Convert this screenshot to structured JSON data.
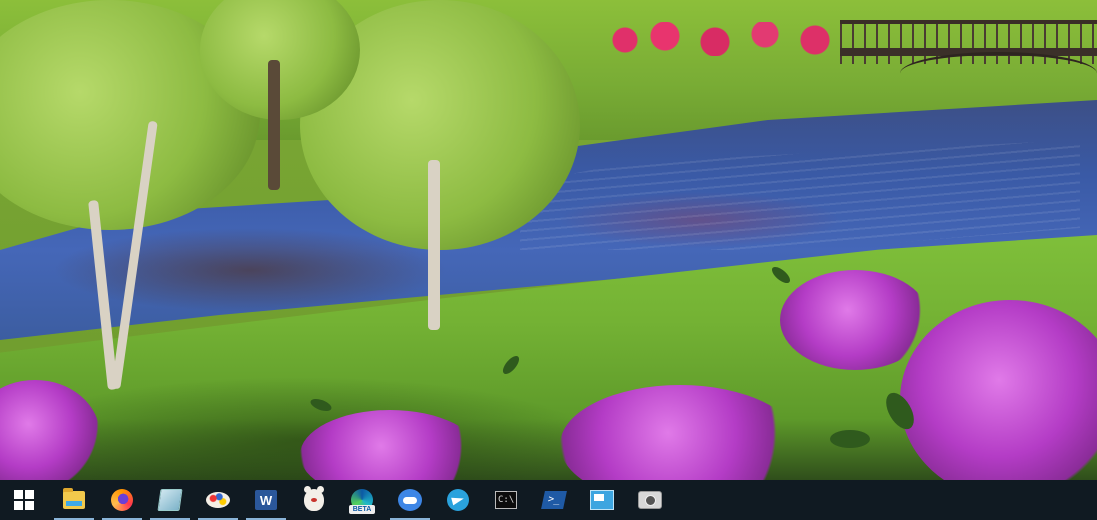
{
  "desktop": {
    "wallpaper": "landscape-pond-bridge-azaleas"
  },
  "taskbar": {
    "background": "#101a22",
    "start": {
      "icon": "windows-start-icon"
    },
    "items": [
      {
        "id": "file-explorer",
        "icon": "folder-icon",
        "active": true
      },
      {
        "id": "firefox",
        "icon": "firefox-icon",
        "active": true
      },
      {
        "id": "app-window",
        "icon": "window-app-icon",
        "active": true
      },
      {
        "id": "paint",
        "icon": "paint-palette-icon",
        "active": true
      },
      {
        "id": "word",
        "icon": "word-icon",
        "label": "W",
        "active": true
      },
      {
        "id": "bear-app",
        "icon": "bear-icon",
        "active": false
      },
      {
        "id": "edge-beta",
        "icon": "edge-beta-icon",
        "label": "BETA",
        "active": false
      },
      {
        "id": "cloud-app",
        "icon": "cloud-icon",
        "active": true
      },
      {
        "id": "telegram",
        "icon": "telegram-icon",
        "active": false
      },
      {
        "id": "command-prompt",
        "icon": "terminal-icon",
        "label": "C:\\",
        "active": false
      },
      {
        "id": "powershell",
        "icon": "powershell-icon",
        "label": ">_",
        "active": false
      },
      {
        "id": "remote-desktop",
        "icon": "monitor-icon",
        "active": false
      },
      {
        "id": "camera",
        "icon": "camera-icon",
        "active": false
      }
    ]
  }
}
